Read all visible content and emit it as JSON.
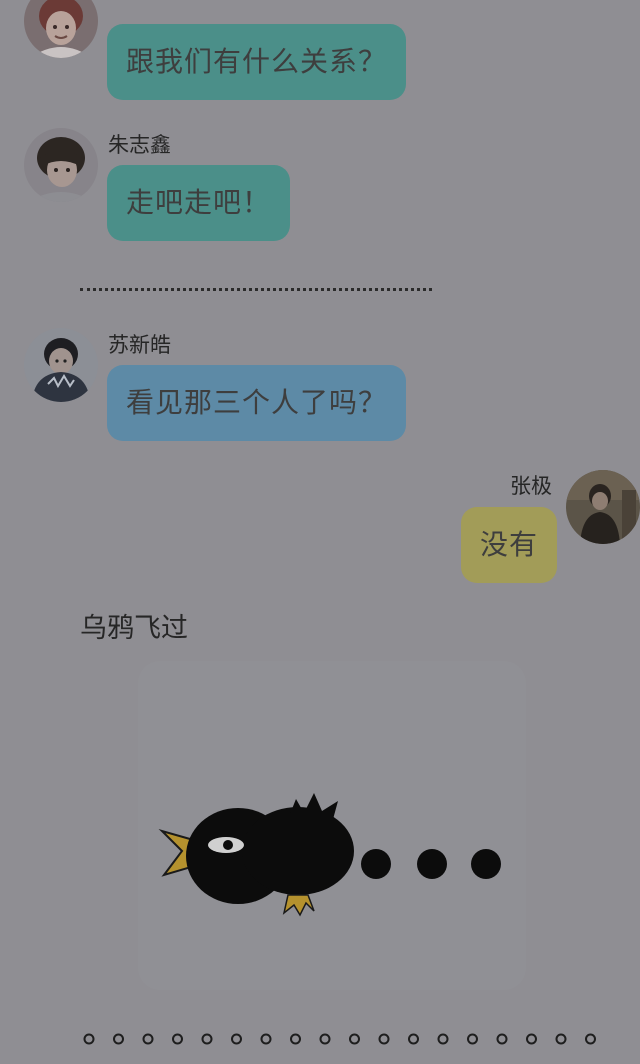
{
  "messages": [
    {
      "id": "m1",
      "sender": "",
      "text": "跟我们有什么关系？",
      "color": "#4b8f89",
      "avatar_icon": "boy-red-hair-avatar"
    },
    {
      "id": "m2",
      "sender": "朱志鑫",
      "text": "走吧走吧！",
      "color": "#4b8f89",
      "avatar_icon": "boy-dark-hair-avatar"
    },
    {
      "id": "m3",
      "sender": "苏新皓",
      "text": "看见那三个人了吗？",
      "color": "#5d8aa6",
      "avatar_icon": "boy-hoodie-avatar"
    },
    {
      "id": "m4",
      "sender": "张极",
      "text": "没有",
      "color": "#a29c58",
      "avatar_icon": "boy-dark-clothes-avatar"
    }
  ],
  "narration": "乌鸦飞过",
  "sticker": {
    "icon": "crow-flying-sticker"
  },
  "colors": {
    "background": "#8f8e93",
    "teal_bubble": "#4b8f89",
    "blue_bubble": "#5d8aa6",
    "yellow_bubble": "#a29c58"
  }
}
